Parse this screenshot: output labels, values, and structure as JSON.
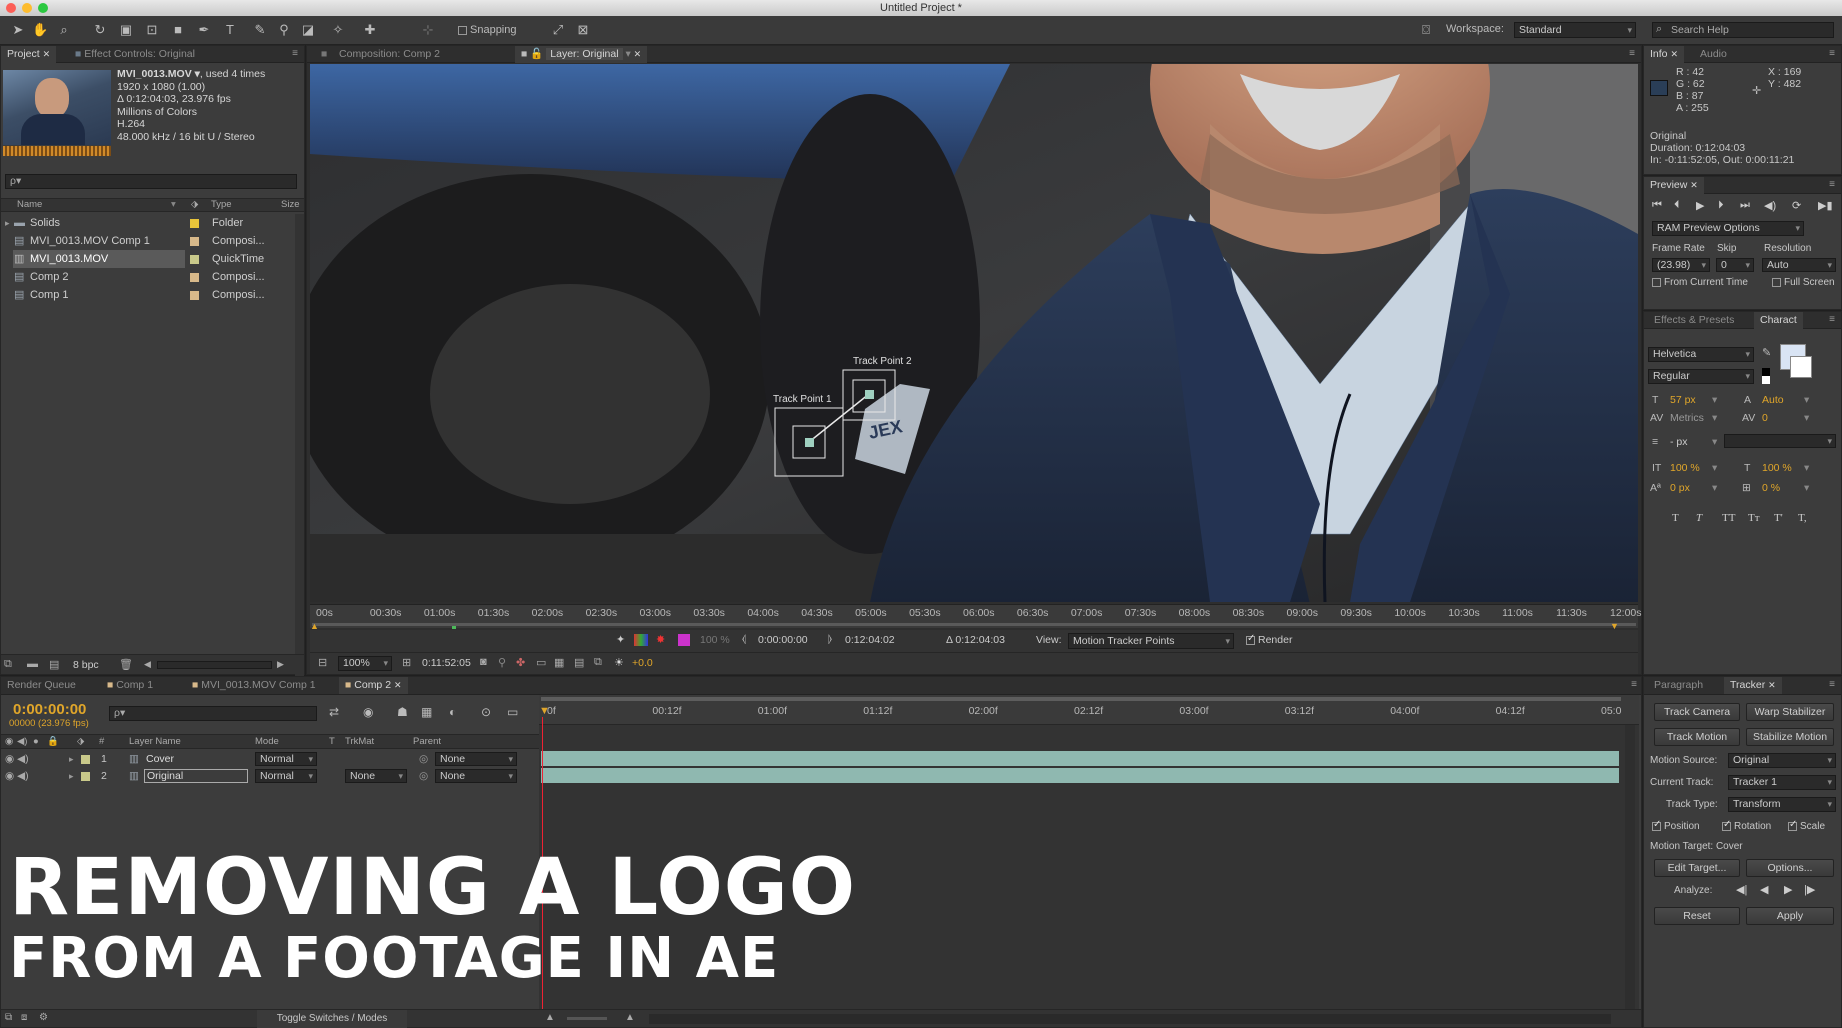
{
  "window": {
    "title": "Untitled Project *"
  },
  "toolbar": {
    "snapping_label": "Snapping",
    "workspace_label": "Workspace:",
    "workspace_value": "Standard",
    "search_placeholder": "Search Help"
  },
  "project_panel": {
    "tabs": [
      "Project",
      "Effect Controls: Original"
    ],
    "footage": {
      "name": "MVI_0013.MOV ▾",
      "used": ", used 4 times",
      "size": "1920 x 1080 (1.00)",
      "duration": "Δ 0:12:04:03, 23.976 fps",
      "colors": "Millions of Colors",
      "codec": "H.264",
      "audio": "48.000 kHz / 16 bit U / Stereo"
    },
    "search_placeholder": "ρ▾",
    "columns": [
      "Name",
      "Type",
      "Size"
    ],
    "items": [
      {
        "name": "Solids",
        "type": "Folder",
        "icon": "folder-icon",
        "color": "#e8c43a"
      },
      {
        "name": "MVI_0013.MOV Comp 1",
        "type": "Composi...",
        "icon": "composition-icon",
        "color": "#d8b98a"
      },
      {
        "name": "MVI_0013.MOV",
        "type": "QuickTime",
        "icon": "footage-icon",
        "color": "#c9c98a"
      },
      {
        "name": "Comp 2",
        "type": "Composi...",
        "icon": "composition-icon",
        "color": "#d8b98a"
      },
      {
        "name": "Comp 1",
        "type": "Composi...",
        "icon": "composition-icon",
        "color": "#d8b98a"
      }
    ],
    "bpc": "8 bpc"
  },
  "viewer": {
    "tabs": [
      "Composition: Comp 2",
      "Layer: Original"
    ],
    "track_point_1": "Track Point 1",
    "track_point_2": "Track Point 2",
    "ruler": [
      "00s",
      "00:30s",
      "01:00s",
      "01:30s",
      "02:00s",
      "02:30s",
      "03:00s",
      "03:30s",
      "04:00s",
      "04:30s",
      "05:00s",
      "05:30s",
      "06:00s",
      "06:30s",
      "07:00s",
      "07:30s",
      "08:00s",
      "08:30s",
      "09:00s",
      "09:30s",
      "10:00s",
      "10:30s",
      "11:00s",
      "11:30s",
      "12:00s"
    ],
    "zoom": "100%",
    "timecode": "0:11:52:05",
    "exposure": "+0.0",
    "opacity": "100 %",
    "in_time": "0:00:00:00",
    "out_time": "0:12:04:02",
    "duration": "Δ 0:12:04:03",
    "view_label": "View:",
    "view_value": "Motion Tracker Points",
    "render_label": "Render"
  },
  "info_panel": {
    "tabs": [
      "Info",
      "Audio"
    ],
    "r": "R : 42",
    "g": "G : 62",
    "b": "B : 87",
    "a": "A : 255",
    "x": "X : 169",
    "y": "Y : 482",
    "layer": "Original",
    "duration": "Duration: 0:12:04:03",
    "inout": "In: -0:11:52:05, Out: 0:00:11:21"
  },
  "preview_panel": {
    "tab": "Preview",
    "ram_options": "RAM Preview Options",
    "frame_rate_label": "Frame Rate",
    "skip_label": "Skip",
    "resolution_label": "Resolution",
    "frame_rate": "(23.98)",
    "skip": "0",
    "resolution": "Auto",
    "from_current": "From Current Time",
    "full_screen": "Full Screen"
  },
  "character_panel": {
    "tabs": [
      "Effects & Presets",
      "Charact"
    ],
    "font": "Helvetica",
    "style": "Regular",
    "size": "57 px",
    "leading": "Auto",
    "kerning": "Metrics",
    "tracking": "0",
    "stroke": "- px",
    "vscale": "100 %",
    "hscale": "100 %",
    "baseline": "0 px",
    "tsume": "0 %",
    "styles": [
      "T",
      "T",
      "TT",
      "Tт",
      "T'",
      "T,"
    ]
  },
  "timeline": {
    "tabs": [
      "Render Queue",
      "Comp 1",
      "MVI_0013.MOV Comp 1",
      "Comp 2"
    ],
    "timecode": "0:00:00:00",
    "fps": "00000 (23.976 fps)",
    "search_placeholder": "ρ▾",
    "columns": {
      "layer_name": "Layer Name",
      "mode": "Mode",
      "t": "T",
      "trkmat": "TrkMat",
      "parent": "Parent"
    },
    "layers": [
      {
        "num": "1",
        "name": "Cover",
        "mode": "Normal",
        "trkmat": "",
        "parent": "None"
      },
      {
        "num": "2",
        "name": "Original",
        "mode": "Normal",
        "trkmat": "None",
        "parent": "None"
      }
    ],
    "ruler": [
      "0f",
      "00:12f",
      "01:00f",
      "01:12f",
      "02:00f",
      "02:12f",
      "03:00f",
      "03:12f",
      "04:00f",
      "04:12f",
      "05:0"
    ],
    "toggle_label": "Toggle Switches / Modes"
  },
  "tracker_panel": {
    "tabs": [
      "Paragraph",
      "Tracker"
    ],
    "track_camera": "Track Camera",
    "warp_stabilizer": "Warp Stabilizer",
    "track_motion": "Track Motion",
    "stabilize_motion": "Stabilize Motion",
    "motion_source_label": "Motion Source:",
    "motion_source": "Original",
    "current_track_label": "Current Track:",
    "current_track": "Tracker 1",
    "track_type_label": "Track Type:",
    "track_type": "Transform",
    "position": "Position",
    "rotation": "Rotation",
    "scale": "Scale",
    "motion_target": "Motion Target: Cover",
    "edit_target": "Edit Target...",
    "options": "Options...",
    "analyze_label": "Analyze:",
    "reset": "Reset",
    "apply": "Apply"
  },
  "overlay": {
    "line1": "REMOVING A LOGO",
    "line2": "FROM A FOOTAGE IN AE"
  },
  "colors": {
    "accent": "#e0a62a",
    "track_bar": "#8fb8b0",
    "swatch": "#2a3e57"
  }
}
